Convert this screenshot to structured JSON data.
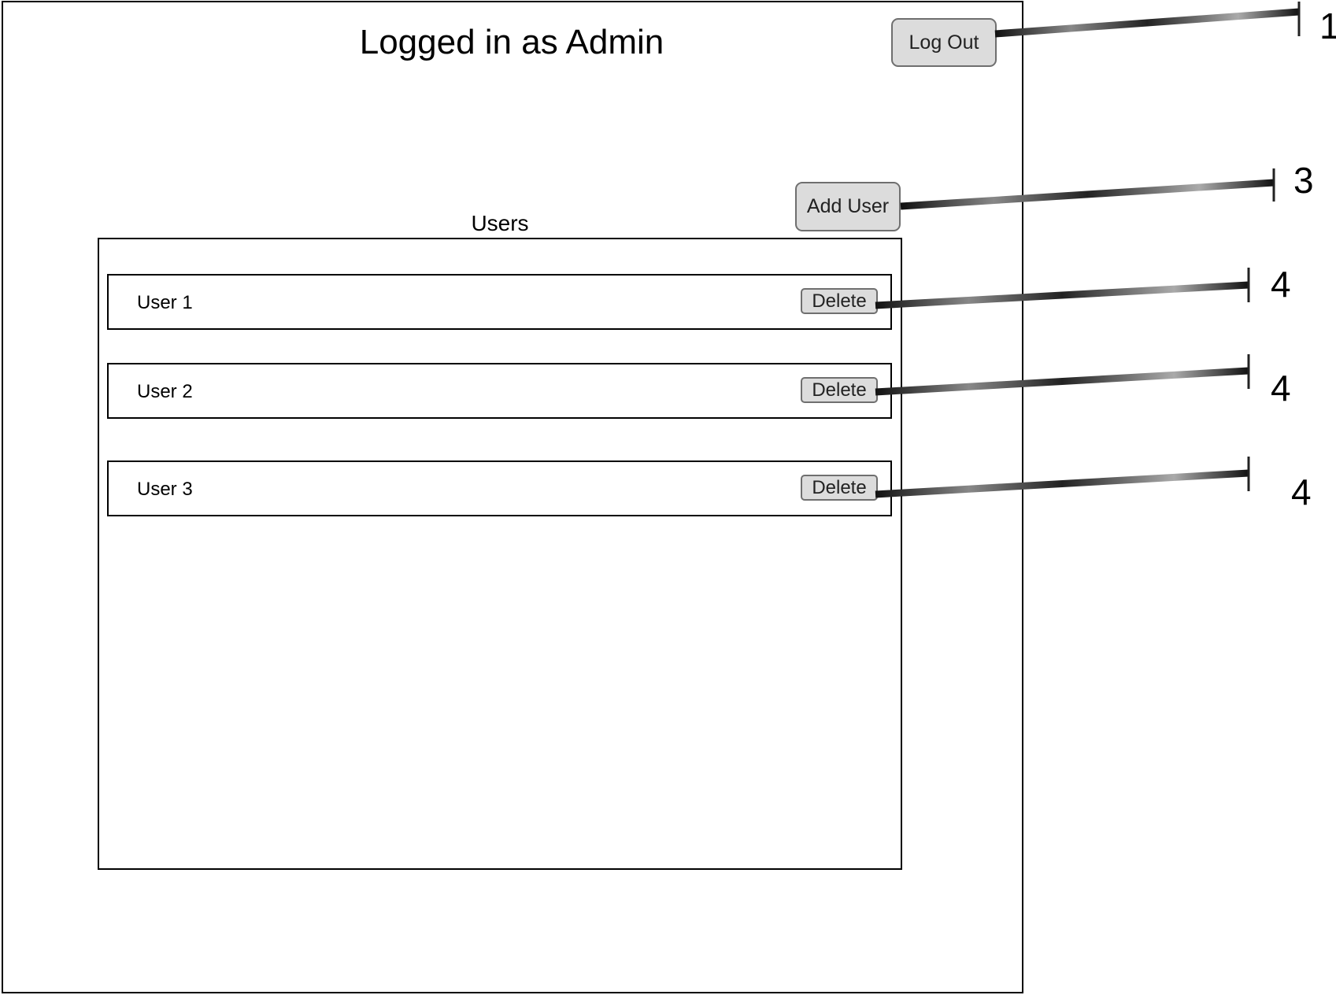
{
  "header": {
    "title": "Logged in as Admin",
    "logout_label": "Log Out"
  },
  "toolbar": {
    "add_user_label": "Add User"
  },
  "users": {
    "heading": "Users",
    "rows": [
      {
        "name": "User 1",
        "delete_label": "Delete"
      },
      {
        "name": "User 2",
        "delete_label": "Delete"
      },
      {
        "name": "User 3",
        "delete_label": "Delete"
      }
    ]
  },
  "callouts": [
    "1",
    "3",
    "4",
    "4",
    "4"
  ]
}
